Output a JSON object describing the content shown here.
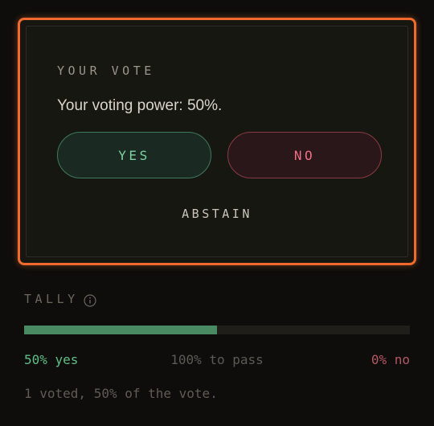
{
  "vote_card": {
    "title": "YOUR VOTE",
    "voting_power_text": "Your voting power: 50%.",
    "yes_label": "YES",
    "no_label": "NO",
    "abstain_label": "ABSTAIN"
  },
  "tally": {
    "title": "TALLY",
    "info_icon": "info-icon",
    "yes_fraction": 0.5,
    "yes_text": "50% yes",
    "pass_text": "100% to pass",
    "no_text": "0% no",
    "summary": "1 voted, 50% of the vote."
  },
  "colors": {
    "accent": "#f06a2e",
    "yes": "#5fbf86",
    "no": "#ef6f83",
    "progress_fill": "#4a8a62"
  }
}
